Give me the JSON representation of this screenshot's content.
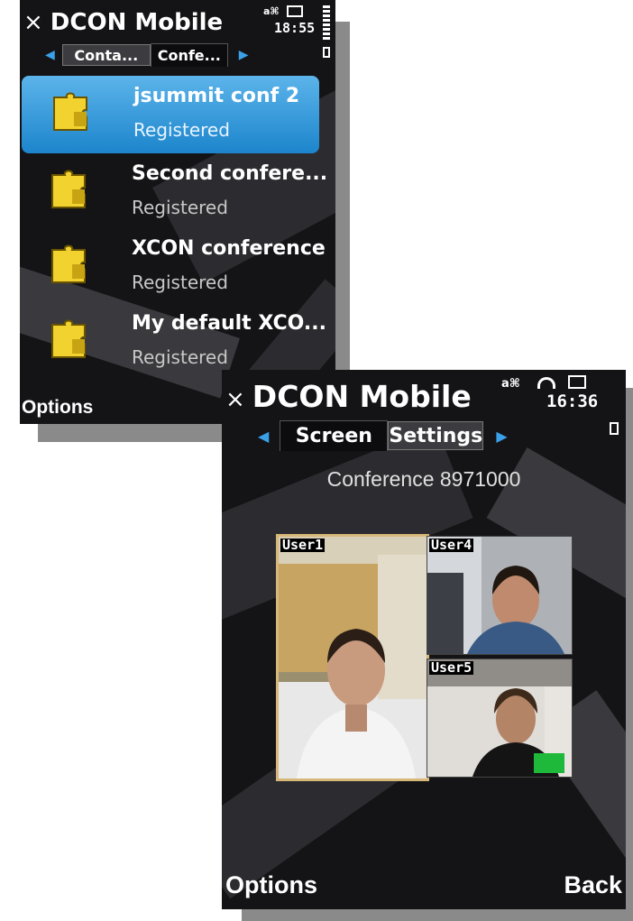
{
  "screen1": {
    "title": "DCON Mobile",
    "close_glyph": "×",
    "clock": "18:55",
    "tabs": [
      {
        "label": "Conta...",
        "active": false
      },
      {
        "label": "Confe...",
        "active": true
      }
    ],
    "conferences": [
      {
        "name": "jsummit conf 2",
        "status": "Registered",
        "selected": true
      },
      {
        "name": "Second confere...",
        "status": "Registered",
        "selected": false
      },
      {
        "name": "XCON conference",
        "status": "Registered",
        "selected": false
      },
      {
        "name": "My default XCO...",
        "status": "Registered",
        "selected": false
      }
    ],
    "softkey_left": "Options",
    "icon": "puzzle-piece-icon",
    "selection_color": "#2a94d8"
  },
  "screen2": {
    "title": "DCON Mobile",
    "close_glyph": "×",
    "clock": "16:36",
    "tabs": [
      {
        "label": "Screen",
        "active": true
      },
      {
        "label": "Settings",
        "active": false
      }
    ],
    "conference_label": "Conference 8971000",
    "participants": [
      {
        "label": "User1",
        "highlighted": true
      },
      {
        "label": "User4",
        "highlighted": false
      },
      {
        "label": "User5",
        "highlighted": false
      }
    ],
    "softkey_left": "Options",
    "softkey_right": "Back",
    "highlight_color": "#d8b878"
  }
}
